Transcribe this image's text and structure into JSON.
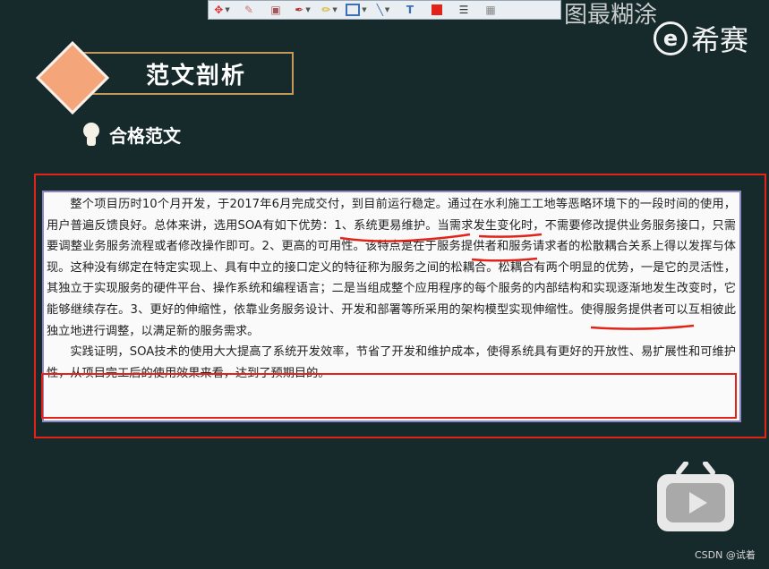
{
  "toolbar": {
    "tools": [
      "move-tool",
      "eraser-tool",
      "stamp-tool",
      "pen-tool",
      "highlighter-tool",
      "rectangle-tool",
      "line-tool",
      "text-tool",
      "color-swatch",
      "line-weight-tool",
      "blur-tool"
    ],
    "overlay_text": "图最糊涂",
    "accent_color": "#e2231a"
  },
  "brand": {
    "logo_letter": "e",
    "name": "希赛"
  },
  "section": {
    "title": "范文剖析",
    "subtitle": "合格范文"
  },
  "document": {
    "paragraph1": "整个项目历时10个月开发，于2017年6月完成交付，到目前运行稳定。通过在水利施工工地等恶略环境下的一段时间的使用，用户普遍反馈良好。总体来讲，选用SOA有如下优势：1、系统更易维护。当需求发生变化时，不需要修改提供业务服务接口，只需要调整业务服务流程或者修改操作即可。2、更高的可用性。该特点是在于服务提供者和服务请求者的松散耦合关系上得以发挥与体现。这种没有绑定在特定实现上、具有中立的接口定义的特征称为服务之间的松耦合。松耦合有两个明显的优势，一是它的灵活性，其独立于实现服务的硬件平台、操作系统和编程语言；二是当组成整个应用程序的每个服务的内部结构和实现逐渐地发生改变时，它能够继续存在。3、更好的伸缩性，依靠业务服务设计、开发和部署等所采用的架构模型实现伸缩性。使得服务提供者可以互相彼此独立地进行调整，以满足新的服务需求。",
    "paragraph2": "实践证明，SOA技术的使用大大提高了系统开发效率，节省了开发和维护成本，使得系统具有更好的开放性、易扩展性和可维护性，从项目完工后的使用效果来看，达到了预期目的。"
  },
  "watermark": "CSDN @试着"
}
